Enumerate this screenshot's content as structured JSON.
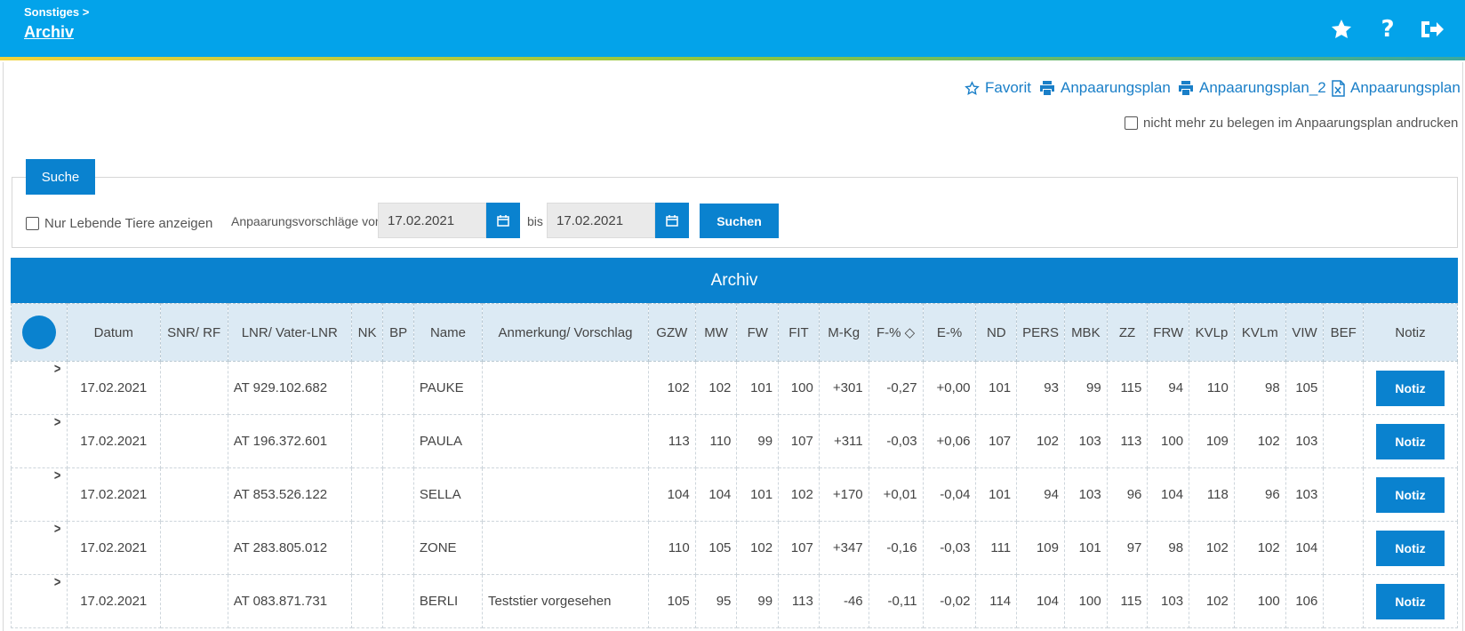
{
  "header": {
    "breadcrumb": "Sonstiges >",
    "title": "Archiv",
    "icons": [
      "star-icon",
      "help-icon",
      "logout-icon"
    ]
  },
  "actions": {
    "favorit": "Favorit",
    "plan1": "Anpaarungsplan",
    "plan2": "Anpaarungsplan_2",
    "plan_excel": "Anpaarungsplan",
    "print_checkbox_label": "nicht mehr zu belegen im Anpaarungsplan andrucken"
  },
  "search": {
    "tab_label": "Suche",
    "living_only_label": "Nur Lebende Tiere anzeigen",
    "from_label": "Anpaarungsvorschläge von",
    "from_value": "17.02.2021",
    "to_label": "bis",
    "to_value": "17.02.2021",
    "button_label": "Suchen"
  },
  "table": {
    "title": "Archiv",
    "columns": [
      "",
      "Datum",
      "SNR/ RF",
      "LNR/ Vater-LNR",
      "NK",
      "BP",
      "Name",
      "Anmerkung/ Vorschlag",
      "GZW",
      "MW",
      "FW",
      "FIT",
      "M-Kg",
      "F-% ◇",
      "E-%",
      "ND",
      "PERS",
      "MBK",
      "ZZ",
      "FRW",
      "KVLp",
      "KVLm",
      "VIW",
      "BEF",
      "Notiz"
    ],
    "notiz_label": "Notiz",
    "rows": [
      {
        "datum": "17.02.2021",
        "snr": "",
        "lnr": "AT 929.102.682",
        "nk": "",
        "bp": "",
        "name": "PAUKE",
        "anmerkung": "",
        "gzw": "102",
        "mw": "102",
        "fw": "101",
        "fit": "100",
        "mkg": "+301",
        "fp": "-0,27",
        "ep": "+0,00",
        "nd": "101",
        "pers": "93",
        "mbk": "99",
        "zz": "115",
        "frw": "94",
        "kvlp": "110",
        "kvlm": "98",
        "viw": "105",
        "bef": ""
      },
      {
        "datum": "17.02.2021",
        "snr": "",
        "lnr": "AT 196.372.601",
        "nk": "",
        "bp": "",
        "name": "PAULA",
        "anmerkung": "",
        "gzw": "113",
        "mw": "110",
        "fw": "99",
        "fit": "107",
        "mkg": "+311",
        "fp": "-0,03",
        "ep": "+0,06",
        "nd": "107",
        "pers": "102",
        "mbk": "103",
        "zz": "113",
        "frw": "100",
        "kvlp": "109",
        "kvlm": "102",
        "viw": "103",
        "bef": ""
      },
      {
        "datum": "17.02.2021",
        "snr": "",
        "lnr": "AT 853.526.122",
        "nk": "",
        "bp": "",
        "name": "SELLA",
        "anmerkung": "",
        "gzw": "104",
        "mw": "104",
        "fw": "101",
        "fit": "102",
        "mkg": "+170",
        "fp": "+0,01",
        "ep": "-0,04",
        "nd": "101",
        "pers": "94",
        "mbk": "103",
        "zz": "96",
        "frw": "104",
        "kvlp": "118",
        "kvlm": "96",
        "viw": "103",
        "bef": ""
      },
      {
        "datum": "17.02.2021",
        "snr": "",
        "lnr": "AT 283.805.012",
        "nk": "",
        "bp": "",
        "name": "ZONE",
        "anmerkung": "",
        "gzw": "110",
        "mw": "105",
        "fw": "102",
        "fit": "107",
        "mkg": "+347",
        "fp": "-0,16",
        "ep": "-0,03",
        "nd": "111",
        "pers": "109",
        "mbk": "101",
        "zz": "97",
        "frw": "98",
        "kvlp": "102",
        "kvlm": "102",
        "viw": "104",
        "bef": ""
      },
      {
        "datum": "17.02.2021",
        "snr": "",
        "lnr": "AT 083.871.731",
        "nk": "",
        "bp": "",
        "name": "BERLI",
        "anmerkung": "Teststier vorgesehen",
        "gzw": "105",
        "mw": "95",
        "fw": "99",
        "fit": "113",
        "mkg": "-46",
        "fp": "-0,11",
        "ep": "-0,02",
        "nd": "114",
        "pers": "104",
        "mbk": "100",
        "zz": "115",
        "frw": "103",
        "kvlp": "102",
        "kvlm": "100",
        "viw": "106",
        "bef": ""
      }
    ]
  },
  "colors": {
    "header_bg": "#03a3ea",
    "accent": "#0a82cf",
    "table_header_bg": "#dceaf4"
  }
}
